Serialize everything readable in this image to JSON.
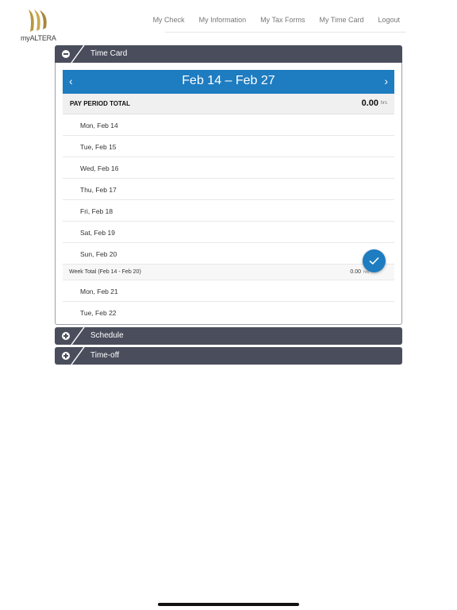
{
  "brand": {
    "logo_text": "myALTERA",
    "logo_color": "#b8973f"
  },
  "nav": {
    "items": [
      {
        "label": "My Check"
      },
      {
        "label": "My Information"
      },
      {
        "label": "My Tax Forms"
      },
      {
        "label": "My Time Card"
      },
      {
        "label": "Logout"
      }
    ]
  },
  "timecard": {
    "section_title": "Time Card",
    "period_label": "Feb 14 – Feb 27",
    "pay_period_total_label": "PAY PERIOD TOTAL",
    "pay_period_total_value": "0.00",
    "hours_unit": "hrs",
    "days_week1": [
      {
        "label": "Mon, Feb 14"
      },
      {
        "label": "Tue, Feb 15"
      },
      {
        "label": "Wed, Feb 16"
      },
      {
        "label": "Thu, Feb 17"
      },
      {
        "label": "Fri, Feb 18"
      },
      {
        "label": "Sat, Feb 19"
      },
      {
        "label": "Sun, Feb 20"
      }
    ],
    "week_total": {
      "label": "Week Total (Feb 14 - Feb 20)",
      "value": "0.00",
      "unit": "hrs"
    },
    "days_week2": [
      {
        "label": "Mon, Feb 21"
      },
      {
        "label": "Tue, Feb 22"
      }
    ]
  },
  "schedule": {
    "section_title": "Schedule"
  },
  "timeoff": {
    "section_title": "Time-off"
  },
  "colors": {
    "accent": "#1e7cc0",
    "header_bar": "#4a4e5c"
  }
}
